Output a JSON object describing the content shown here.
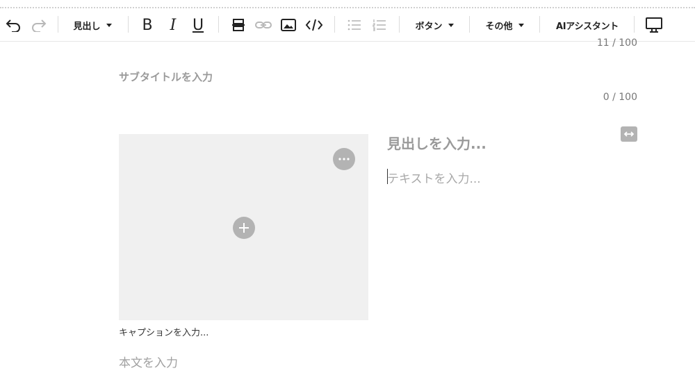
{
  "toolbar": {
    "undo_icon": "undo-icon",
    "redo_icon": "redo-icon",
    "heading_dropdown": "見出し",
    "bold_label": "B",
    "italic_label": "I",
    "underline_label": "U",
    "strike_icon": "strikethrough-icon",
    "link_icon": "link-icon",
    "image_icon": "image-icon",
    "code_icon": "code-icon",
    "bullet_list_icon": "bulleted-list-icon",
    "numbered_list_icon": "numbered-list-icon",
    "button_dropdown": "ボタン",
    "other_dropdown": "その他",
    "ai_assistant": "AIアシスタント",
    "preview_icon": "monitor-icon"
  },
  "editor": {
    "title_counter": "11 / 100",
    "subtitle_placeholder": "サブタイトルを入力",
    "subtitle_counter": "0 / 100",
    "block": {
      "heading_placeholder": "見出しを入力...",
      "text_placeholder": "テキストを入力...",
      "caption_placeholder": "キャプションを入力..."
    },
    "body_placeholder": "本文を入力"
  },
  "colors": {
    "placeholder": "#9a9a9a",
    "image_bg": "#f0f0f0",
    "icon_circle": "#b3b3b3"
  }
}
